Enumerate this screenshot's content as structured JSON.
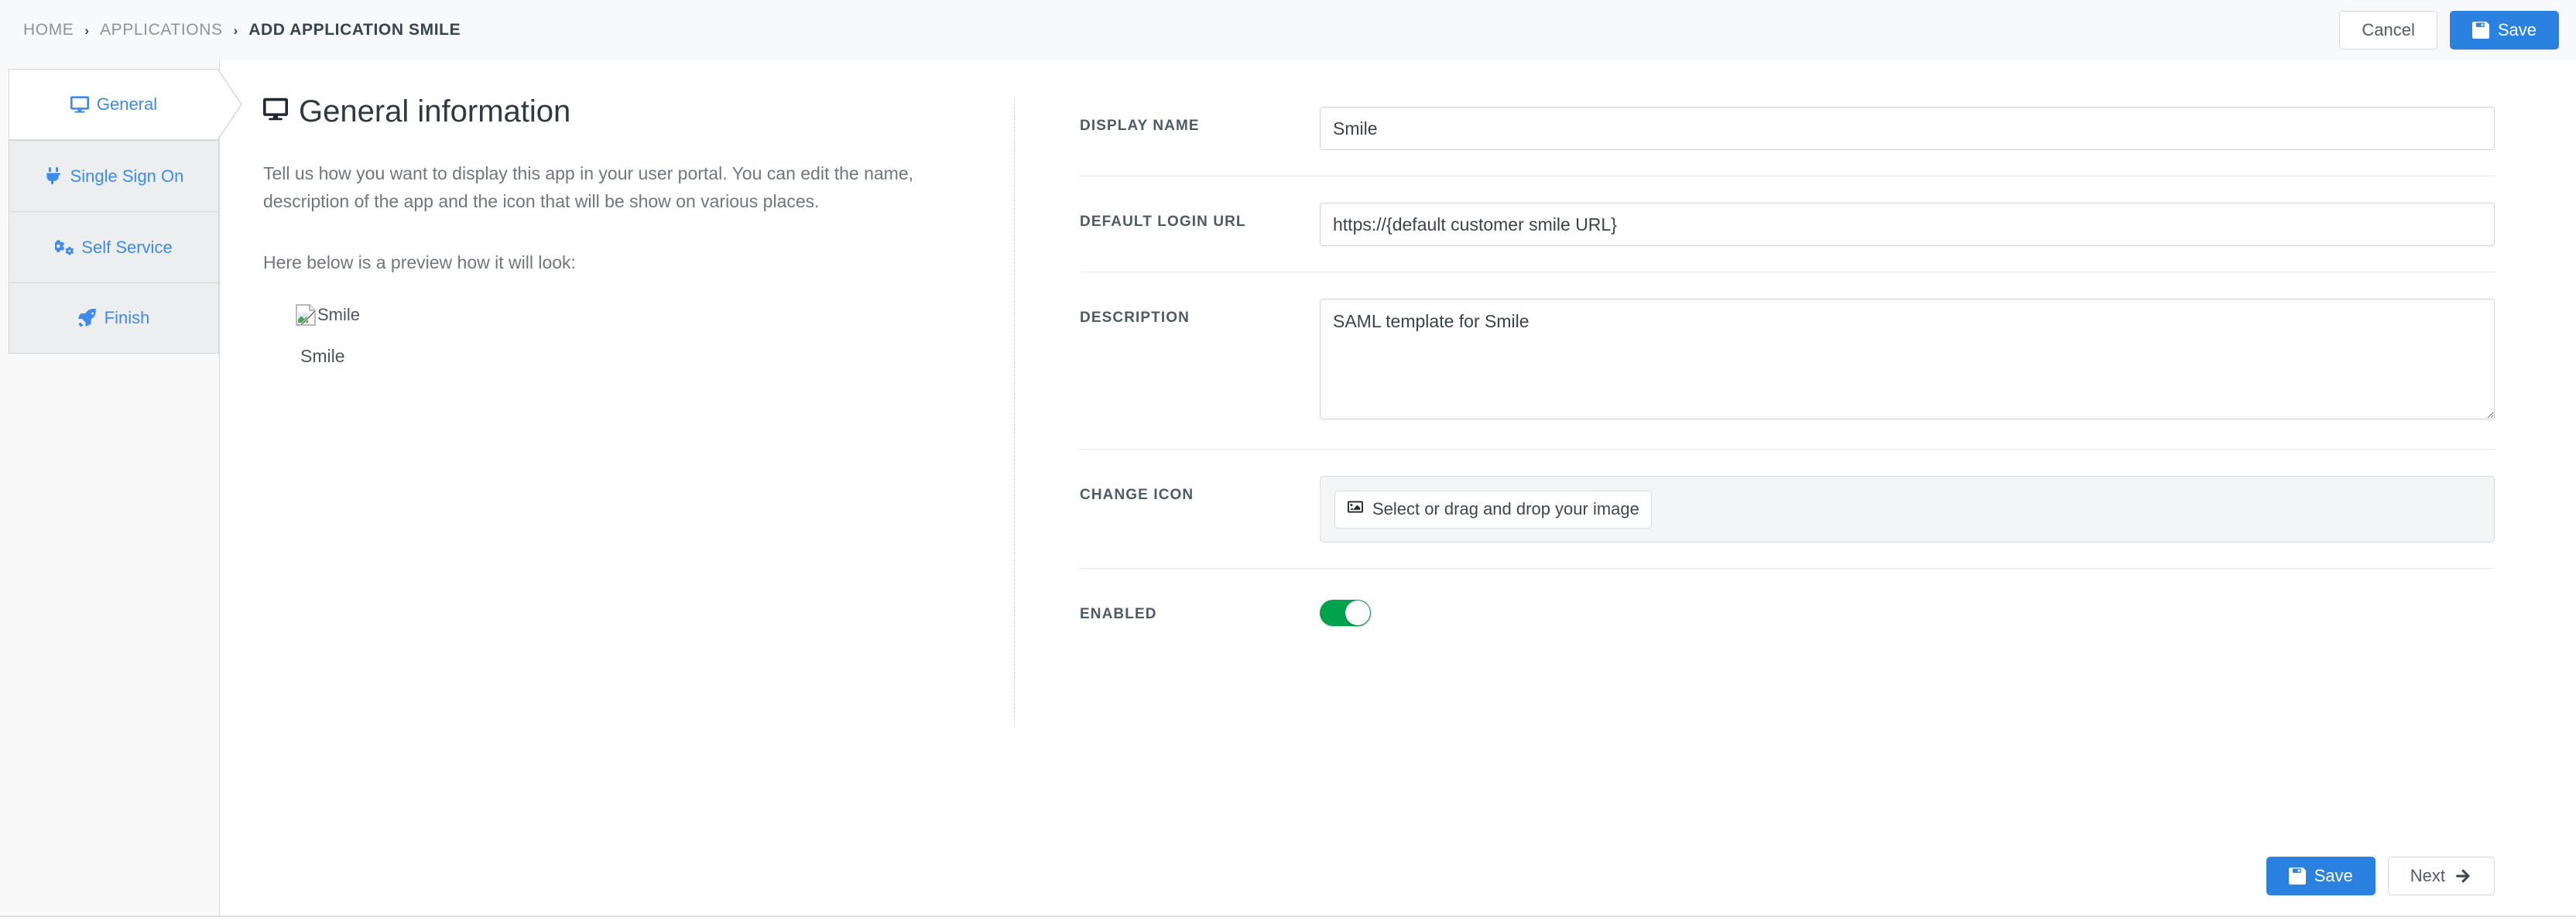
{
  "breadcrumb": {
    "items": [
      {
        "label": "HOME",
        "active": false
      },
      {
        "label": "APPLICATIONS",
        "active": false
      },
      {
        "label": "ADD APPLICATION SMILE",
        "active": true
      }
    ],
    "separator": "›"
  },
  "topbar": {
    "cancel_label": "Cancel",
    "save_label": "Save"
  },
  "wizard": {
    "steps": [
      {
        "label": "General",
        "icon": "desktop-icon",
        "active": true
      },
      {
        "label": "Single Sign On",
        "icon": "plug-icon",
        "active": false
      },
      {
        "label": "Self Service",
        "icon": "cogs-icon",
        "active": false
      },
      {
        "label": "Finish",
        "icon": "rocket-icon",
        "active": false
      }
    ]
  },
  "info": {
    "title": "General information",
    "title_icon": "desktop-icon",
    "intro": "Tell us how you want to display this app in your user portal. You can edit the name, description of the app and the icon that will be show on various places.",
    "preview_label": "Here below is a preview how it will look:",
    "preview_alt_text": "Smile",
    "preview_name": "Smile"
  },
  "form": {
    "display_name": {
      "label": "DISPLAY NAME",
      "value": "Smile",
      "placeholder": ""
    },
    "default_login_url": {
      "label": "DEFAULT LOGIN URL",
      "value": "https://{default customer smile URL}",
      "placeholder": ""
    },
    "description": {
      "label": "DESCRIPTION",
      "value": "SAML template for Smile",
      "placeholder": ""
    },
    "change_icon": {
      "label": "CHANGE ICON",
      "button_label": "Select or drag and drop your image"
    },
    "enabled": {
      "label": "ENABLED",
      "state": "on"
    }
  },
  "footer": {
    "save_label": "Save",
    "next_label": "Next"
  },
  "colors": {
    "primary": "#2b81e0",
    "link": "#3d8bef",
    "toggle_on": "#00a24c",
    "label": "#4d5a67",
    "header_bg": "#f8f9fa"
  }
}
